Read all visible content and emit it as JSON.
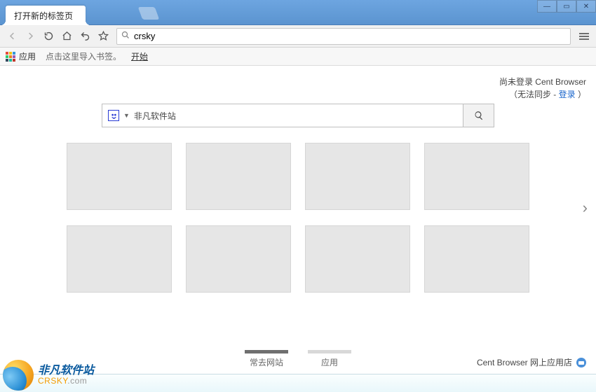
{
  "titlebar": {
    "tab_title": "打开新的标签页"
  },
  "toolbar": {
    "omnibox_value": "crsky"
  },
  "bookmarkbar": {
    "apps_label": "应用",
    "import_hint": "点击这里导入书签。",
    "start_label": "开始"
  },
  "content": {
    "login_line1": "尚未登录 Cent Browser",
    "login_line2_pre": "（无法同步 - ",
    "login_link": "登录",
    "login_line2_post": " ）",
    "search_provider_label": "非凡软件站",
    "bottom_tabs": {
      "frequent": "常去网站",
      "apps": "应用"
    },
    "store_label": "Cent Browser 网上应用店"
  },
  "watermark": {
    "line1": "非凡软件站",
    "line2_a": "CRSKY",
    "line2_b": ".com"
  }
}
